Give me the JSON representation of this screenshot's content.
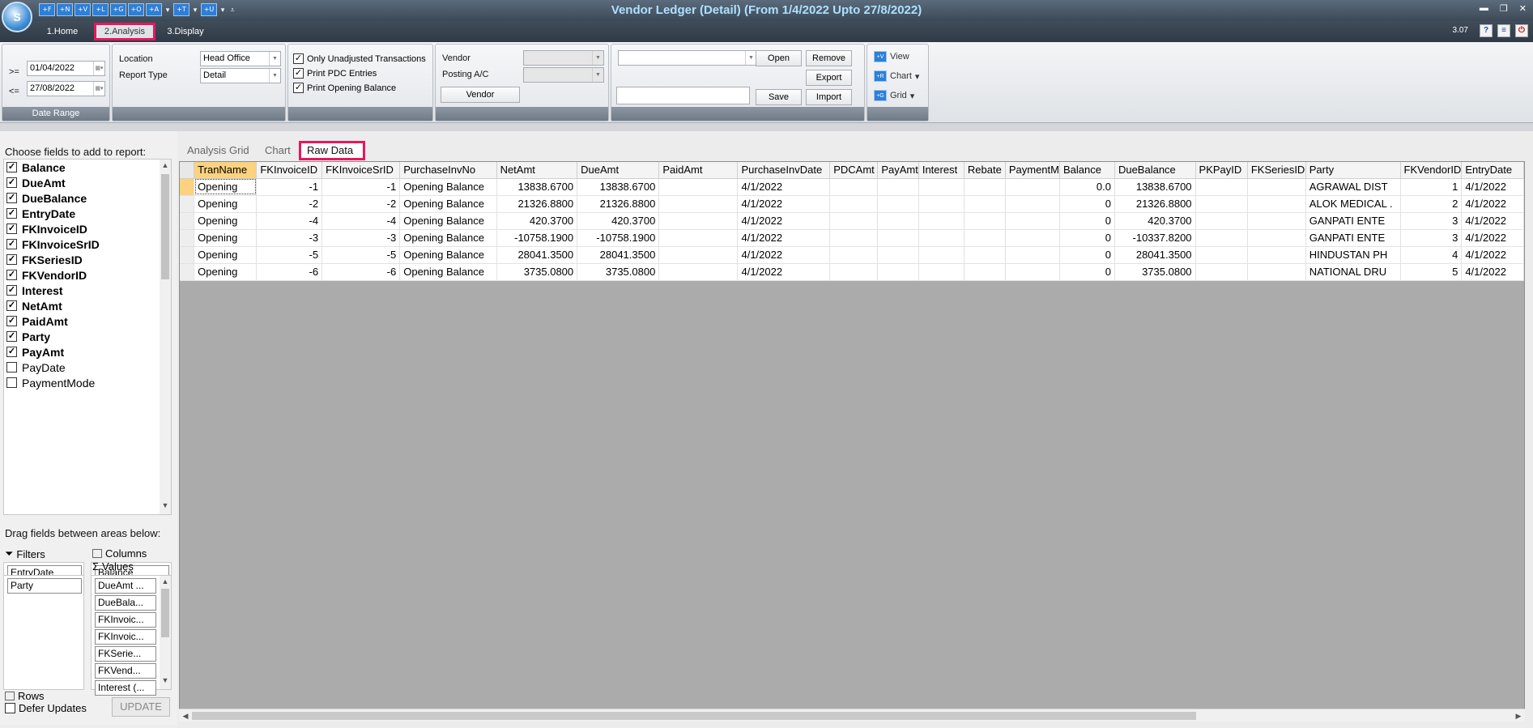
{
  "window": {
    "title": "Vendor Ledger (Detail)  (From 1/4/2022 Upto 27/8/2022)",
    "version": "3.07",
    "app_logo_letter": "S",
    "qat_buttons": [
      "+F",
      "+N",
      "+V",
      "+L",
      "+G",
      "+O",
      "+A",
      "+T",
      "+U"
    ],
    "controls": [
      "▬",
      "❐",
      "✕"
    ]
  },
  "ribbon_tabs": [
    "1.Home",
    "2.Analysis",
    "3.Display"
  ],
  "date_range": {
    "from_label": ">=",
    "from_value": "01/04/2022",
    "to_label": "<=",
    "to_value": "27/08/2022",
    "caption": "Date Range"
  },
  "location_group": {
    "location_label": "Location",
    "location_value": "Head Office",
    "report_type_label": "Report Type",
    "report_type_value": "Detail"
  },
  "options_group": {
    "checkboxes": [
      {
        "label": "Only Unadjusted Transactions",
        "checked": true
      },
      {
        "label": "Print PDC Entries",
        "checked": true
      },
      {
        "label": "Print Opening Balance",
        "checked": true
      }
    ]
  },
  "vendor_group": {
    "vendor_label": "Vendor",
    "posting_label": "Posting A/C",
    "vendor_button": "Vendor"
  },
  "layout_group": {
    "open": "Open",
    "remove": "Remove",
    "export": "Export",
    "save": "Save",
    "import": "Import"
  },
  "view_group": {
    "view": "View",
    "chart": "Chart",
    "grid": "Grid",
    "view_icon": "+V",
    "chart_icon": "+R",
    "grid_icon": "+G"
  },
  "fieldlist": {
    "choose_label": "Choose fields to add to report:",
    "fields": [
      {
        "label": "Balance",
        "checked": true
      },
      {
        "label": "DueAmt",
        "checked": true
      },
      {
        "label": "DueBalance",
        "checked": true
      },
      {
        "label": "EntryDate",
        "checked": true
      },
      {
        "label": "FKInvoiceID",
        "checked": true
      },
      {
        "label": "FKInvoiceSrID",
        "checked": true
      },
      {
        "label": "FKSeriesID",
        "checked": true
      },
      {
        "label": "FKVendorID",
        "checked": true
      },
      {
        "label": "Interest",
        "checked": true
      },
      {
        "label": "NetAmt",
        "checked": true
      },
      {
        "label": "PaidAmt",
        "checked": true
      },
      {
        "label": "Party",
        "checked": true
      },
      {
        "label": "PayAmt",
        "checked": true
      },
      {
        "label": "PayDate",
        "checked": false
      },
      {
        "label": "PaymentMode",
        "checked": false
      }
    ],
    "drag_label": "Drag fields between areas below:",
    "filters_label": "Filters",
    "filters_items": [
      "EntryDate"
    ],
    "columns_label": "Columns",
    "columns_items": [
      "Balance"
    ],
    "rows_label": "Rows",
    "rows_items": [
      "Party"
    ],
    "values_label": "Values",
    "values_items": [
      "DueAmt ...",
      "DueBala...",
      "FKInvoic...",
      "FKInvoic...",
      "FKSerie...",
      "FKVend...",
      "Interest (..."
    ],
    "defer_label": "Defer Updates",
    "update_button": "UPDATE"
  },
  "grid_tabs": [
    "Analysis Grid",
    "Chart",
    "Raw Data"
  ],
  "grid": {
    "columns": [
      "TranName",
      "FKInvoiceID",
      "FKInvoiceSrID",
      "PurchaseInvNo",
      "NetAmt",
      "DueAmt",
      "PaidAmt",
      "PurchaseInvDate",
      "PDCAmt",
      "PayAmt",
      "Interest",
      "Rebate",
      "PaymentM",
      "Balance",
      "DueBalance",
      "PKPayID",
      "FKSeriesID",
      "Party",
      "FKVendorID",
      "EntryDate"
    ],
    "rows": [
      [
        "Opening",
        "-1",
        "-1",
        "Opening Balance",
        "13838.6700",
        "13838.6700",
        "",
        "4/1/2022",
        "",
        "",
        "",
        "",
        "",
        "0.0",
        "13838.6700",
        "",
        "",
        "AGRAWAL DIST",
        "1",
        "4/1/2022"
      ],
      [
        "Opening",
        "-2",
        "-2",
        "Opening Balance",
        "21326.8800",
        "21326.8800",
        "",
        "4/1/2022",
        "",
        "",
        "",
        "",
        "",
        "0",
        "21326.8800",
        "",
        "",
        "ALOK MEDICAL .",
        "2",
        "4/1/2022"
      ],
      [
        "Opening",
        "-4",
        "-4",
        "Opening Balance",
        "420.3700",
        "420.3700",
        "",
        "4/1/2022",
        "",
        "",
        "",
        "",
        "",
        "0",
        "420.3700",
        "",
        "",
        "GANPATI ENTE",
        "3",
        "4/1/2022"
      ],
      [
        "Opening",
        "-3",
        "-3",
        "Opening Balance",
        "-10758.1900",
        "-10758.1900",
        "",
        "4/1/2022",
        "",
        "",
        "",
        "",
        "",
        "0",
        "-10337.8200",
        "",
        "",
        "GANPATI ENTE",
        "3",
        "4/1/2022"
      ],
      [
        "Opening",
        "-5",
        "-5",
        "Opening Balance",
        "28041.3500",
        "28041.3500",
        "",
        "4/1/2022",
        "",
        "",
        "",
        "",
        "",
        "0",
        "28041.3500",
        "",
        "",
        "HINDUSTAN PH",
        "4",
        "4/1/2022"
      ],
      [
        "Opening",
        "-6",
        "-6",
        "Opening Balance",
        "3735.0800",
        "3735.0800",
        "",
        "4/1/2022",
        "",
        "",
        "",
        "",
        "",
        "0",
        "3735.0800",
        "",
        "",
        "NATIONAL DRU",
        "5",
        "4/1/2022"
      ]
    ]
  },
  "colors": {
    "highlight": "#e8175d",
    "selected_header": "#fbd27f",
    "title": "#aee0ff"
  }
}
